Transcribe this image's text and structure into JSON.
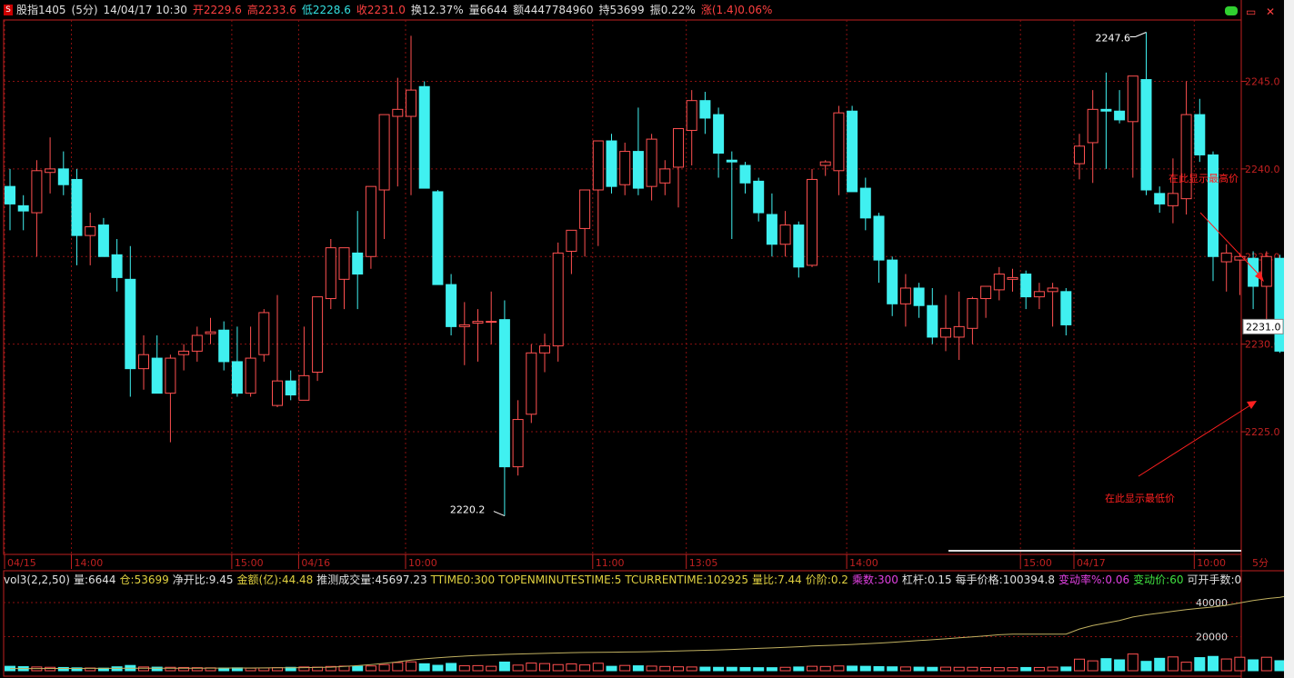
{
  "header": {
    "logo": "S",
    "symbol": "股指1405",
    "period": "(5分)",
    "datetime": "14/04/17 10:30",
    "open": "开2229.6",
    "high": "高2233.6",
    "low": "低2228.6",
    "close": "收2231.0",
    "turnover": "换12.37%",
    "volume": "量6644",
    "amount": "额4447784960",
    "position": "持53699",
    "amplitude": "振0.22%",
    "change": "涨(1.4)0.06%"
  },
  "vol_header": {
    "name": "vol3(2,2,50)",
    "vol": "量:6644",
    "oi": "仓:53699",
    "ratio": "净开比:9.45",
    "amount": "金额(亿):44.48",
    "est": "推测成交量:45697.23",
    "ttime": "TTIME0:300",
    "topen": "TOPENMINUTESTIME:5",
    "tcur": "TCURRENTIME:102925",
    "vratio": "量比:7.44",
    "tick": "价阶:0.2",
    "mult": "乘数:300",
    "lev": "杠杆:0.15",
    "perhand": "每手价格:100394.8",
    "chg": "变动率%:0.06",
    "chgp": "变动价:60",
    "avail": "可开手数:0"
  },
  "colors": {
    "up": "#ff5050",
    "down": "#40f0f0",
    "grid": "#8b1010",
    "axis": "#c02020",
    "annot": "#ff2020",
    "oiLine": "#c0b060"
  },
  "chart_data": {
    "type": "candlestick",
    "ylim": [
      2218,
      2248.5
    ],
    "yticks": [
      "2225.0",
      "2230.0",
      "2235.0",
      "2240.0",
      "2245.0"
    ],
    "ytick_values": [
      2225,
      2230,
      2235,
      2240,
      2245
    ],
    "current_price": "2231.0",
    "high_label": "2247.6",
    "low_label": "2220.2",
    "x_labels": [
      {
        "i": 0,
        "text": "04/15"
      },
      {
        "i": 5,
        "text": "14:00"
      },
      {
        "i": 17,
        "text": "15:00"
      },
      {
        "i": 22,
        "text": "04/16"
      },
      {
        "i": 30,
        "text": "10:00"
      },
      {
        "i": 44,
        "text": "11:00"
      },
      {
        "i": 51,
        "text": "13:05"
      },
      {
        "i": 63,
        "text": "14:00"
      },
      {
        "i": 76,
        "text": "15:00"
      },
      {
        "i": 80,
        "text": "04/17"
      },
      {
        "i": 89,
        "text": "10:00"
      }
    ],
    "period_label": "5分",
    "annotations": [
      "在此显示最高价",
      "在此显示最低价"
    ],
    "vol_ylim": [
      0,
      48000
    ],
    "vol_yticks": [
      "20000",
      "40000"
    ],
    "vol_ytick_values": [
      20000,
      40000
    ],
    "candles": [
      [
        2239.0,
        2240.0,
        2236.5,
        2238.0
      ],
      [
        2237.9,
        2238.5,
        2236.5,
        2237.6
      ],
      [
        2237.5,
        2240.5,
        2235.0,
        2239.9
      ],
      [
        2239.8,
        2241.8,
        2238.6,
        2240.0
      ],
      [
        2240.0,
        2241.0,
        2238.5,
        2239.1
      ],
      [
        2239.4,
        2240.0,
        2234.5,
        2236.2
      ],
      [
        2236.2,
        2237.5,
        2234.5,
        2236.7
      ],
      [
        2236.8,
        2237.2,
        2235.0,
        2235.0
      ],
      [
        2235.1,
        2236.0,
        2233.0,
        2233.8
      ],
      [
        2233.7,
        2235.6,
        2227.0,
        2228.6
      ],
      [
        2228.6,
        2230.5,
        2227.4,
        2229.4
      ],
      [
        2229.2,
        2230.5,
        2227.6,
        2227.2
      ],
      [
        2227.2,
        2229.4,
        2224.4,
        2229.2
      ],
      [
        2229.4,
        2230.0,
        2228.5,
        2229.6
      ],
      [
        2229.6,
        2231.0,
        2229.0,
        2230.5
      ],
      [
        2230.6,
        2231.5,
        2230.0,
        2230.7
      ],
      [
        2230.8,
        2231.3,
        2228.5,
        2229.0
      ],
      [
        2229.0,
        2231.0,
        2227.0,
        2227.2
      ],
      [
        2227.2,
        2231.0,
        2227.0,
        2229.2
      ],
      [
        2229.4,
        2232.0,
        2229.0,
        2231.8
      ],
      [
        2226.5,
        2232.8,
        2226.4,
        2227.9
      ],
      [
        2227.9,
        2228.5,
        2226.8,
        2227.1
      ],
      [
        2226.8,
        2231.0,
        2226.8,
        2228.2
      ],
      [
        2228.4,
        2232.2,
        2227.9,
        2232.7
      ],
      [
        2232.6,
        2236.0,
        2232.0,
        2235.5
      ],
      [
        2233.7,
        2235.5,
        2232.0,
        2235.5
      ],
      [
        2235.2,
        2237.6,
        2232.0,
        2234.0
      ],
      [
        2235.0,
        2238.5,
        2234.3,
        2239.0
      ],
      [
        2238.8,
        2242.0,
        2236.0,
        2243.1
      ],
      [
        2243.0,
        2245.2,
        2239.0,
        2243.4
      ],
      [
        2243.0,
        2247.6,
        2238.5,
        2244.5
      ],
      [
        2244.7,
        2245.0,
        2240.5,
        2238.9
      ],
      [
        2238.7,
        2238.8,
        2233.6,
        2233.4
      ],
      [
        2233.4,
        2234.0,
        2230.5,
        2231.0
      ],
      [
        2231.0,
        2232.4,
        2228.8,
        2231.1
      ],
      [
        2231.2,
        2232.0,
        2229.0,
        2231.3
      ],
      [
        2231.3,
        2233.0,
        2230.0,
        2231.3
      ],
      [
        2231.4,
        2232.5,
        2220.2,
        2223.0
      ],
      [
        2223.0,
        2226.8,
        2222.5,
        2225.7
      ],
      [
        2226.0,
        2230.0,
        2225.5,
        2229.5
      ],
      [
        2229.5,
        2230.6,
        2228.4,
        2229.9
      ],
      [
        2229.9,
        2235.8,
        2229.0,
        2235.2
      ],
      [
        2235.3,
        2236.4,
        2234.0,
        2236.5
      ],
      [
        2236.6,
        2238.5,
        2235.0,
        2238.8
      ],
      [
        2238.8,
        2239.8,
        2235.6,
        2241.6
      ],
      [
        2241.6,
        2242.0,
        2238.6,
        2239.0
      ],
      [
        2239.1,
        2241.5,
        2238.5,
        2241.0
      ],
      [
        2241.0,
        2243.5,
        2238.5,
        2238.9
      ],
      [
        2239.0,
        2242.0,
        2238.2,
        2241.7
      ],
      [
        2239.2,
        2240.5,
        2238.5,
        2240.0
      ],
      [
        2240.1,
        2241.5,
        2237.8,
        2242.3
      ],
      [
        2242.2,
        2244.5,
        2240.2,
        2243.9
      ],
      [
        2243.9,
        2244.4,
        2242.0,
        2242.9
      ],
      [
        2243.1,
        2243.5,
        2239.5,
        2240.9
      ],
      [
        2240.5,
        2241.0,
        2236.0,
        2240.4
      ],
      [
        2240.2,
        2240.4,
        2238.6,
        2239.2
      ],
      [
        2239.3,
        2239.5,
        2237.0,
        2237.5
      ],
      [
        2237.4,
        2238.6,
        2235.0,
        2235.7
      ],
      [
        2235.7,
        2237.6,
        2235.0,
        2236.8
      ],
      [
        2236.8,
        2237.0,
        2233.8,
        2234.4
      ],
      [
        2234.5,
        2240.0,
        2234.4,
        2239.4
      ],
      [
        2240.2,
        2240.5,
        2239.6,
        2240.4
      ],
      [
        2239.9,
        2243.6,
        2238.5,
        2243.2
      ],
      [
        2243.3,
        2243.6,
        2238.8,
        2238.7
      ],
      [
        2238.9,
        2239.5,
        2236.5,
        2237.2
      ],
      [
        2237.3,
        2237.5,
        2233.5,
        2234.8
      ],
      [
        2234.8,
        2235.0,
        2231.6,
        2232.3
      ],
      [
        2232.3,
        2234.0,
        2231.0,
        2233.2
      ],
      [
        2233.2,
        2233.5,
        2231.5,
        2232.2
      ],
      [
        2232.2,
        2233.2,
        2230.0,
        2230.4
      ],
      [
        2230.4,
        2232.8,
        2229.6,
        2230.9
      ],
      [
        2230.4,
        2233.0,
        2229.1,
        2231.0
      ],
      [
        2230.9,
        2232.7,
        2230.0,
        2232.6
      ],
      [
        2232.6,
        2233.0,
        2231.5,
        2233.3
      ],
      [
        2233.1,
        2234.4,
        2232.5,
        2234.0
      ],
      [
        2233.7,
        2234.3,
        2233.0,
        2233.8
      ],
      [
        2234.0,
        2234.2,
        2232.0,
        2232.7
      ],
      [
        2232.7,
        2233.5,
        2232.0,
        2233.0
      ],
      [
        2233.0,
        2233.5,
        2231.0,
        2233.2
      ],
      [
        2233.0,
        2233.2,
        2230.5,
        2231.1
      ],
      [
        2240.3,
        2242.0,
        2239.4,
        2241.3
      ],
      [
        2241.5,
        2244.5,
        2239.2,
        2243.4
      ],
      [
        2243.4,
        2245.5,
        2240.0,
        2243.3
      ],
      [
        2243.3,
        2244.5,
        2242.6,
        2242.8
      ],
      [
        2242.7,
        2245.0,
        2239.5,
        2245.3
      ],
      [
        2245.1,
        2247.8,
        2238.5,
        2238.8
      ],
      [
        2238.6,
        2239.0,
        2237.5,
        2238.0
      ],
      [
        2237.9,
        2240.6,
        2236.9,
        2238.6
      ],
      [
        2238.3,
        2245.0,
        2237.4,
        2243.1
      ],
      [
        2243.1,
        2244.0,
        2240.4,
        2240.8
      ],
      [
        2240.8,
        2241.0,
        2233.6,
        2235.0
      ],
      [
        2234.7,
        2235.7,
        2233.0,
        2235.2
      ],
      [
        2234.8,
        2235.2,
        2232.8,
        2235.0
      ],
      [
        2234.9,
        2235.3,
        2232.0,
        2233.3
      ],
      [
        2233.3,
        2235.3,
        2230.8,
        2235.0
      ],
      [
        2234.9,
        2235.1,
        2229.5,
        2229.6
      ],
      [
        2229.6,
        2233.2,
        2229.0,
        2231.0
      ]
    ],
    "volumes": [
      2600,
      2400,
      2200,
      2000,
      1900,
      1700,
      1600,
      1500,
      2300,
      3100,
      2200,
      2100,
      2000,
      1900,
      1800,
      1700,
      1600,
      1700,
      1500,
      1600,
      1800,
      2000,
      2200,
      2100,
      2500,
      2700,
      2600,
      2800,
      3600,
      4800,
      5200,
      4100,
      3200,
      4300,
      2900,
      3000,
      2600,
      5100,
      3300,
      4500,
      4200,
      3600,
      4000,
      3400,
      4400,
      2600,
      3100,
      2900,
      2700,
      2500,
      2300,
      2200,
      2100,
      2000,
      2000,
      1900,
      1800,
      1800,
      2000,
      2200,
      2600,
      2500,
      2800,
      2700,
      2600,
      2400,
      2300,
      2200,
      2100,
      2000,
      2100,
      2000,
      2000,
      1900,
      1800,
      1800,
      1900,
      1900,
      2100,
      2200,
      6800,
      5800,
      7100,
      6400,
      9800,
      5500,
      7300,
      8100,
      5000,
      7700,
      8400,
      6900,
      7900,
      6400,
      7900,
      5900,
      7100
    ],
    "oi_line": [
      1300,
      1300,
      1300,
      1350,
      1350,
      1350,
      1400,
      1400,
      1400,
      1450,
      1450,
      1450,
      1500,
      1500,
      1500,
      1550,
      1550,
      1600,
      1600,
      1650,
      1700,
      1750,
      1800,
      1900,
      2100,
      2500,
      3000,
      3600,
      4300,
      5200,
      6300,
      7000,
      7600,
      8100,
      8600,
      9000,
      9300,
      9600,
      9800,
      10000,
      10200,
      10400,
      10600,
      10700,
      10800,
      10900,
      11000,
      11100,
      11200,
      11400,
      11600,
      11800,
      12000,
      12200,
      12500,
      12800,
      13100,
      13400,
      13700,
      14100,
      14500,
      14800,
      15100,
      15400,
      15800,
      16200,
      16700,
      17200,
      17700,
      18200,
      18700,
      19300,
      19900,
      20500,
      21100,
      21500,
      21500,
      21500,
      21500,
      21500,
      24500,
      26500,
      28000,
      29500,
      31500,
      32800,
      33800,
      34900,
      35900,
      36700,
      37400,
      38400,
      39800,
      41200,
      42300,
      43100,
      44500
    ]
  }
}
